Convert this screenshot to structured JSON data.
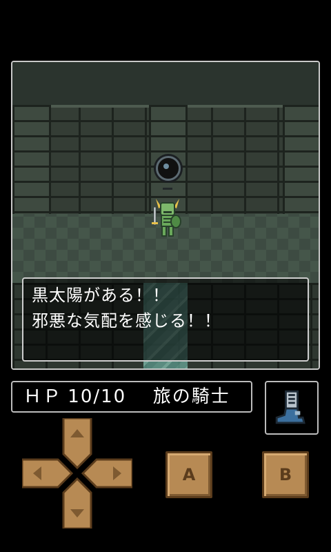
{
  "message": {
    "lines": [
      "黒太陽がある！！",
      "邪悪な気配を感じる！！"
    ]
  },
  "status": {
    "hp_label": "ＨＰ",
    "hp_value": "10/10",
    "character_title": "旅の騎士"
  },
  "controls": {
    "a_label": "A",
    "b_label": "B"
  },
  "icons": {
    "boots": "boots-icon",
    "dpad": "dpad-icon",
    "dark_sun": "black-sun-icon",
    "knight": "knight-icon"
  },
  "colors": {
    "button_fill": "#b78a54",
    "button_border": "#5b3c1c",
    "panel_border": "#bdbdbd"
  }
}
